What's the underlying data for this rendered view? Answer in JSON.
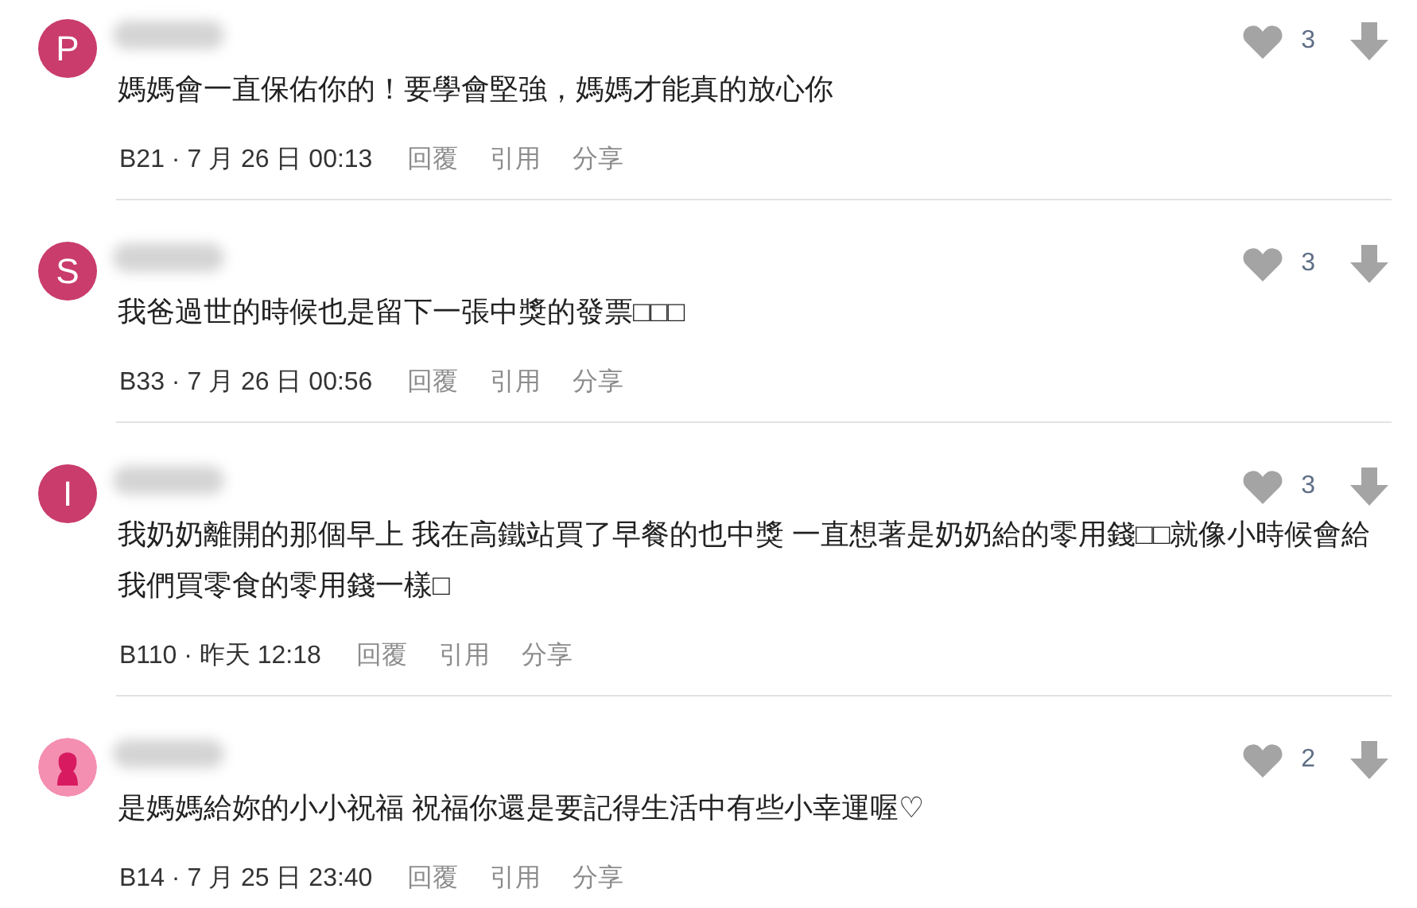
{
  "comments": [
    {
      "avatar": {
        "kind": "letter",
        "letter": "P"
      },
      "text": "媽媽會一直保佑你的！要學會堅強，媽媽才能真的放心你",
      "meta": "B21 · 7 月 26 日 00:13",
      "likes": "3",
      "actions": [
        "回覆",
        "引用",
        "分享"
      ]
    },
    {
      "avatar": {
        "kind": "letter",
        "letter": "S"
      },
      "text": "我爸過世的時候也是留下一張中獎的發票□□□",
      "meta": "B33 · 7 月 26 日 00:56",
      "likes": "3",
      "actions": [
        "回覆",
        "引用",
        "分享"
      ]
    },
    {
      "avatar": {
        "kind": "letter",
        "letter": "I"
      },
      "text": "我奶奶離開的那個早上 我在高鐵站買了早餐的也中獎 一直想著是奶奶給的零用錢□□就像小時候會給我們買零食的零用錢一樣□",
      "meta": "B110 · 昨天 12:18",
      "likes": "3",
      "actions": [
        "回覆",
        "引用",
        "分享"
      ]
    },
    {
      "avatar": {
        "kind": "silhouette"
      },
      "text": "是媽媽給妳的小小祝福 祝福你還是要記得生活中有些小幸運喔♡",
      "meta": "B14 · 7 月 25 日 23:40",
      "likes": "2",
      "actions": [
        "回覆",
        "引用",
        "分享"
      ]
    }
  ]
}
